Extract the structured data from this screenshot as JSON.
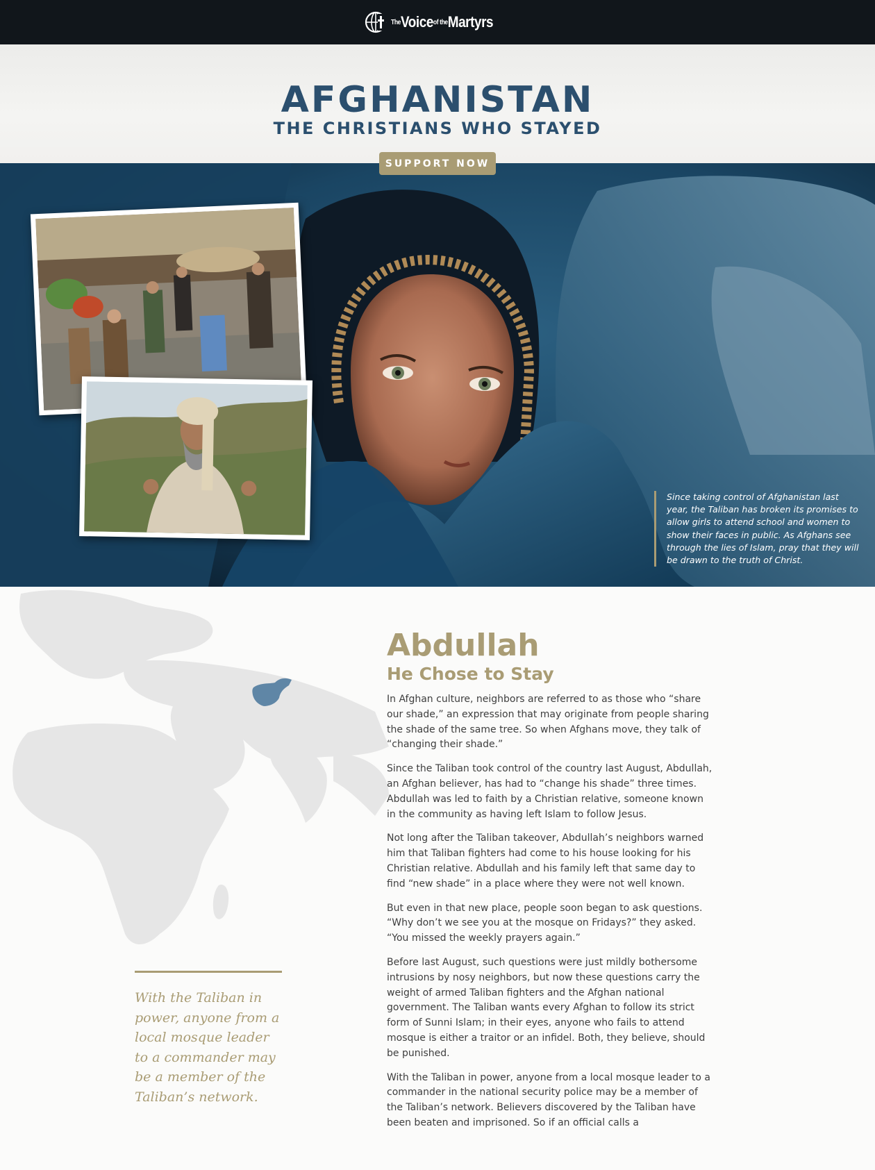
{
  "header": {
    "logo": {
      "icon": "globe-cross-icon",
      "the": "The",
      "voice": "Voice",
      "of_the": "of the",
      "martyrs": "Martyrs"
    }
  },
  "title": {
    "main": "AFGHANISTAN",
    "sub": "THE CHRISTIANS WHO STAYED",
    "cta": "SUPPORT NOW"
  },
  "hero": {
    "quote": "Since taking control of Afghanistan last year, the Taliban has broken its promises to allow girls to attend school and women to show their faces in public. As Afghans see through the lies of Islam, pray that they will be drawn to the truth of Christ."
  },
  "story": {
    "name": "Abdullah",
    "subtitle": "He Chose to Stay",
    "paragraphs": [
      "In Afghan culture, neighbors are referred to as those who “share our shade,” an expression that may originate from people sharing the shade of the same tree. So when Afghans move, they talk of “changing their shade.”",
      "Since the Taliban took control of the country last August, Abdullah, an Afghan believer, has had to “change his shade” three times. Abdullah was led to faith by a Christian relative, someone known in the community as having left Islam to follow Jesus.",
      "Not long after the Taliban takeover, Abdullah’s neighbors warned him that Taliban fighters had come to his house looking for his Christian relative. Abdullah and his family left that same day to find “new shade” in a place where they were not well known.",
      "But even in that new place, people soon began to ask questions. “Why don’t we see you at the mosque on Fridays?” they asked. “You missed the weekly prayers again.”",
      "Before last August, such questions were just mildly bothersome intrusions by nosy neighbors, but now these questions carry the weight of armed Taliban fighters and the Afghan national government. The Taliban wants every Afghan to follow its strict form of Sunni Islam; in their eyes, anyone who fails to attend mosque is either a traitor or an infidel. Both, they believe, should be punished.",
      "With the Taliban in power, anyone from a local mosque leader to a commander in the national security police may be a member of the Taliban’s network. Believers discovered by the Taliban have been beaten and imprisoned. So if an official calls a"
    ]
  },
  "pull_quote": "With the Taliban in power, anyone from a local mosque leader to a commander may be a member of the Taliban’s network.",
  "colors": {
    "navy": "#2b4f6e",
    "gold": "#a99c74",
    "topbar": "#11161b",
    "afghanistan_highlight": "#5f86a6"
  }
}
